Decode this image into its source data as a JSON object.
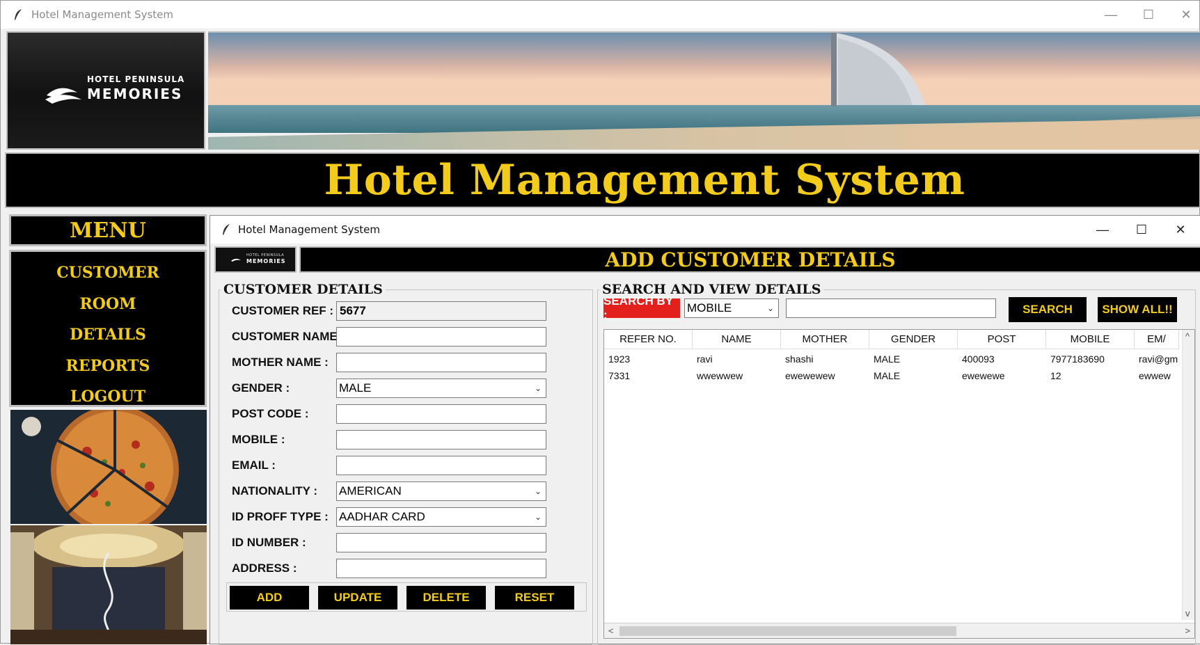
{
  "window": {
    "title": "Hotel Management System",
    "controls": {
      "minimize": "—",
      "maximize": "☐",
      "close": "✕"
    }
  },
  "header": {
    "logo_line1": "HOTEL PENINSULA",
    "logo_line2": "MEMORIES",
    "app_title": "Hotel Management System"
  },
  "menu": {
    "heading": "MENU",
    "items": [
      {
        "label": "CUSTOMER"
      },
      {
        "label": "ROOM"
      },
      {
        "label": "DETAILS"
      },
      {
        "label": "REPORTS"
      },
      {
        "label": "LOGOUT"
      }
    ]
  },
  "inner_window": {
    "title": "Hotel Management System",
    "controls": {
      "minimize": "—",
      "maximize": "☐",
      "close": "✕"
    },
    "mini_logo_line1": "HOTEL PENINSULA",
    "mini_logo_line2": "MEMORIES",
    "heading": "ADD CUSTOMER DETAILS"
  },
  "customer_details": {
    "frame_label": "CUSTOMER DETAILS",
    "fields": {
      "ref": {
        "label": "CUSTOMER REF :",
        "value": "5677"
      },
      "name": {
        "label": "CUSTOMER NAME :",
        "value": ""
      },
      "mother": {
        "label": "MOTHER NAME :",
        "value": ""
      },
      "gender": {
        "label": "GENDER :",
        "value": "MALE"
      },
      "post": {
        "label": "POST CODE :",
        "value": ""
      },
      "mobile": {
        "label": "MOBILE :",
        "value": ""
      },
      "email": {
        "label": "EMAIL :",
        "value": ""
      },
      "nationality": {
        "label": "NATIONALITY :",
        "value": "AMERICAN"
      },
      "idtype": {
        "label": "ID PROFF TYPE :",
        "value": "AADHAR CARD"
      },
      "idnumber": {
        "label": "ID NUMBER :",
        "value": ""
      },
      "address": {
        "label": "ADDRESS :",
        "value": ""
      }
    },
    "buttons": {
      "add": "ADD",
      "update": "UPDATE",
      "delete": "DELETE",
      "reset": "RESET"
    }
  },
  "search_view": {
    "frame_label": "SEARCH AND VIEW DETAILS",
    "search_by_label": "SEARCH BY :",
    "search_by_value": "MOBILE",
    "search_text": "",
    "search_button": "SEARCH",
    "show_all_button": "SHOW ALL!!",
    "columns": [
      "REFER NO.",
      "NAME",
      "MOTHER",
      "GENDER",
      "POST",
      "MOBILE",
      "EM/"
    ],
    "rows": [
      [
        "1923",
        "ravi",
        "shashi",
        "MALE",
        "400093",
        "7977183690",
        "ravi@gm"
      ],
      [
        "7331",
        "wwewwew",
        "ewewewew",
        "MALE",
        "ewewewe",
        "12",
        "ewwew"
      ]
    ],
    "scroll": {
      "up": "^",
      "down": "v",
      "left": "<",
      "right": ">"
    }
  }
}
